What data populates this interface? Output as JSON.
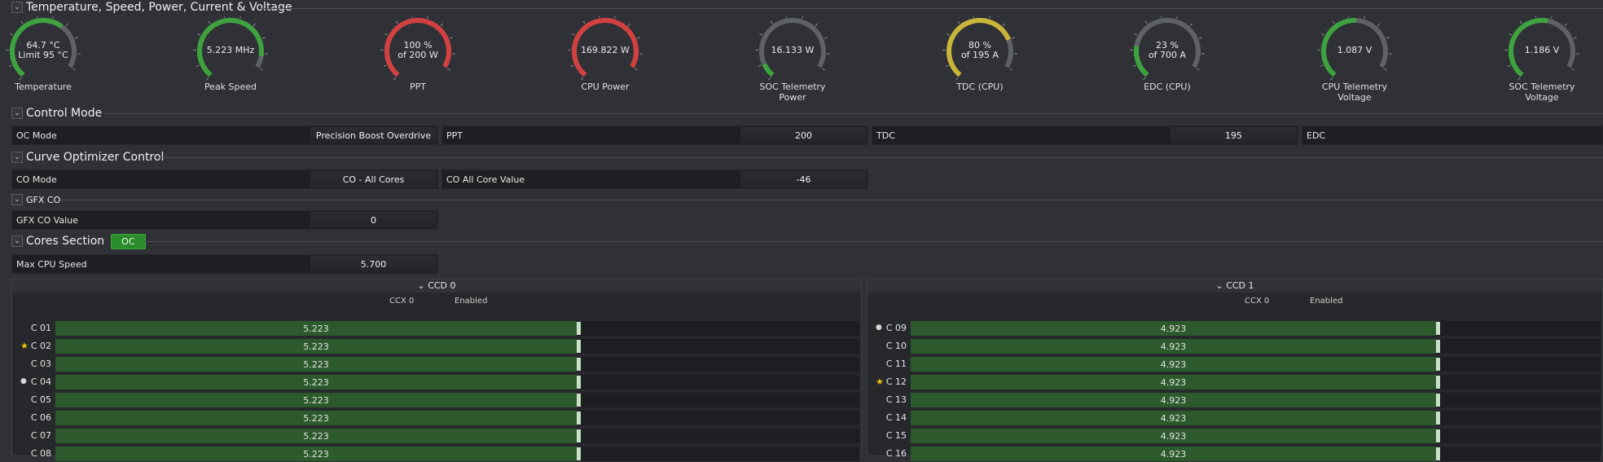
{
  "sections": {
    "temp": "Temperature, Speed, Power, Current & Voltage",
    "control": "Control Mode",
    "curve": "Curve Optimizer Control",
    "gfx": "GFX CO",
    "cores": "Cores Section"
  },
  "gauges": [
    {
      "v1": "64.7 °C",
      "v2": "Limit 95 °C",
      "label1": "Temperature",
      "label2": "",
      "color": "#3ea33e",
      "fill": 0.68
    },
    {
      "v1": "5.223  MHz",
      "v2": "",
      "label1": "Peak Speed",
      "label2": "",
      "color": "#3ea33e",
      "fill": 0.92
    },
    {
      "v1": "100 %",
      "v2": "of 200 W",
      "label1": "PPT",
      "label2": "",
      "color": "#d24040",
      "fill": 1.0
    },
    {
      "v1": "169.822 W",
      "v2": "",
      "label1": "CPU Power",
      "label2": "",
      "color": "#d24040",
      "fill": 1.0
    },
    {
      "v1": "16.133 W",
      "v2": "",
      "label1": "SOC Telemetry",
      "label2": "Power",
      "color": "#3ea33e",
      "fill": 0.1
    },
    {
      "v1": "80 %",
      "v2": "of 195 A",
      "label1": "TDC (CPU)",
      "label2": "",
      "color": "#c9b53a",
      "fill": 0.8
    },
    {
      "v1": "23 %",
      "v2": "of 700 A",
      "label1": "EDC (CPU)",
      "label2": "",
      "color": "#3ea33e",
      "fill": 0.23
    },
    {
      "v1": "1.087 V",
      "v2": "",
      "label1": "CPU Telemetry",
      "label2": "Voltage",
      "color": "#3ea33e",
      "fill": 0.55
    },
    {
      "v1": "1.186 V",
      "v2": "",
      "label1": "SOC Telemetry",
      "label2": "Voltage",
      "color": "#3ea33e",
      "fill": 0.58
    }
  ],
  "control": {
    "oc_mode_label": "OC Mode",
    "oc_mode_value": "Precision Boost Overdrive",
    "ppt_label": "PPT",
    "ppt_value": "200",
    "tdc_label": "TDC",
    "tdc_value": "195",
    "edc_label": "EDC",
    "edc_value": ""
  },
  "curve": {
    "co_mode_label": "CO Mode",
    "co_mode_value": "CO - All Cores",
    "co_all_label": "CO All Core Value",
    "co_all_value": "-46"
  },
  "gfx": {
    "label": "GFX CO Value",
    "value": "0"
  },
  "cores": {
    "badge": "OC",
    "max_label": "Max CPU Speed",
    "max_value": "5.700"
  },
  "ccd": [
    {
      "title": "CCD 0",
      "ccx": "CCX 0",
      "status": "Enabled",
      "cores": [
        {
          "name": "C 01",
          "value": "5.223",
          "marker": ""
        },
        {
          "name": "C 02",
          "value": "5.223",
          "marker": "star"
        },
        {
          "name": "C 03",
          "value": "5.223",
          "marker": ""
        },
        {
          "name": "C 04",
          "value": "5.223",
          "marker": "dot"
        },
        {
          "name": "C 05",
          "value": "5.223",
          "marker": ""
        },
        {
          "name": "C 06",
          "value": "5.223",
          "marker": ""
        },
        {
          "name": "C 07",
          "value": "5.223",
          "marker": ""
        },
        {
          "name": "C 08",
          "value": "5.223",
          "marker": ""
        }
      ]
    },
    {
      "title": "CCD 1",
      "ccx": "CCX 0",
      "status": "Enabled",
      "cores": [
        {
          "name": "C 09",
          "value": "4.923",
          "marker": "dot"
        },
        {
          "name": "C 10",
          "value": "4.923",
          "marker": ""
        },
        {
          "name": "C 11",
          "value": "4.923",
          "marker": ""
        },
        {
          "name": "C 12",
          "value": "4.923",
          "marker": "star"
        },
        {
          "name": "C 13",
          "value": "4.923",
          "marker": ""
        },
        {
          "name": "C 14",
          "value": "4.923",
          "marker": ""
        },
        {
          "name": "C 15",
          "value": "4.923",
          "marker": ""
        },
        {
          "name": "C 16",
          "value": "4.923",
          "marker": ""
        }
      ]
    }
  ],
  "colors": {
    "accent_green": "#3ea33e",
    "warn_red": "#d24040",
    "warn_yellow": "#c9b53a",
    "bar_green": "#2d5a2d"
  }
}
